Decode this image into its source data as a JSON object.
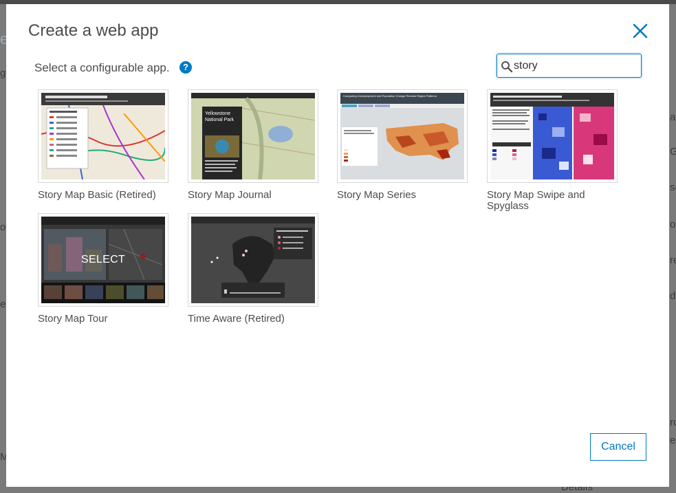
{
  "background": {
    "fragments": [
      "e",
      "g",
      "or",
      "e",
      "Ma",
      "Details",
      "ap",
      "Gl",
      "se",
      "o",
      "re",
      "da",
      "ro",
      "er"
    ]
  },
  "dialog": {
    "title": "Create a web app",
    "subtitle": "Select a configurable app.",
    "help_icon": "question-circle-icon",
    "help_glyph": "?",
    "search": {
      "value": "story",
      "icon": "search-icon"
    },
    "close_icon": "close-icon",
    "accent_color": "#0079c1",
    "apps": [
      {
        "name": "Story Map Basic (Retired)"
      },
      {
        "name": "Story Map Journal",
        "thumb_heading": "Yellowstone National Park"
      },
      {
        "name": "Story Map Series",
        "thumb_heading": "Comparing Unemployment and Population Change Reveals Region Patterns"
      },
      {
        "name": "Story Map Swipe and Spyglass"
      },
      {
        "name": "Story Map Tour",
        "overlay_label": "SELECT"
      },
      {
        "name": "Time Aware (Retired)"
      }
    ],
    "cancel_label": "Cancel"
  }
}
